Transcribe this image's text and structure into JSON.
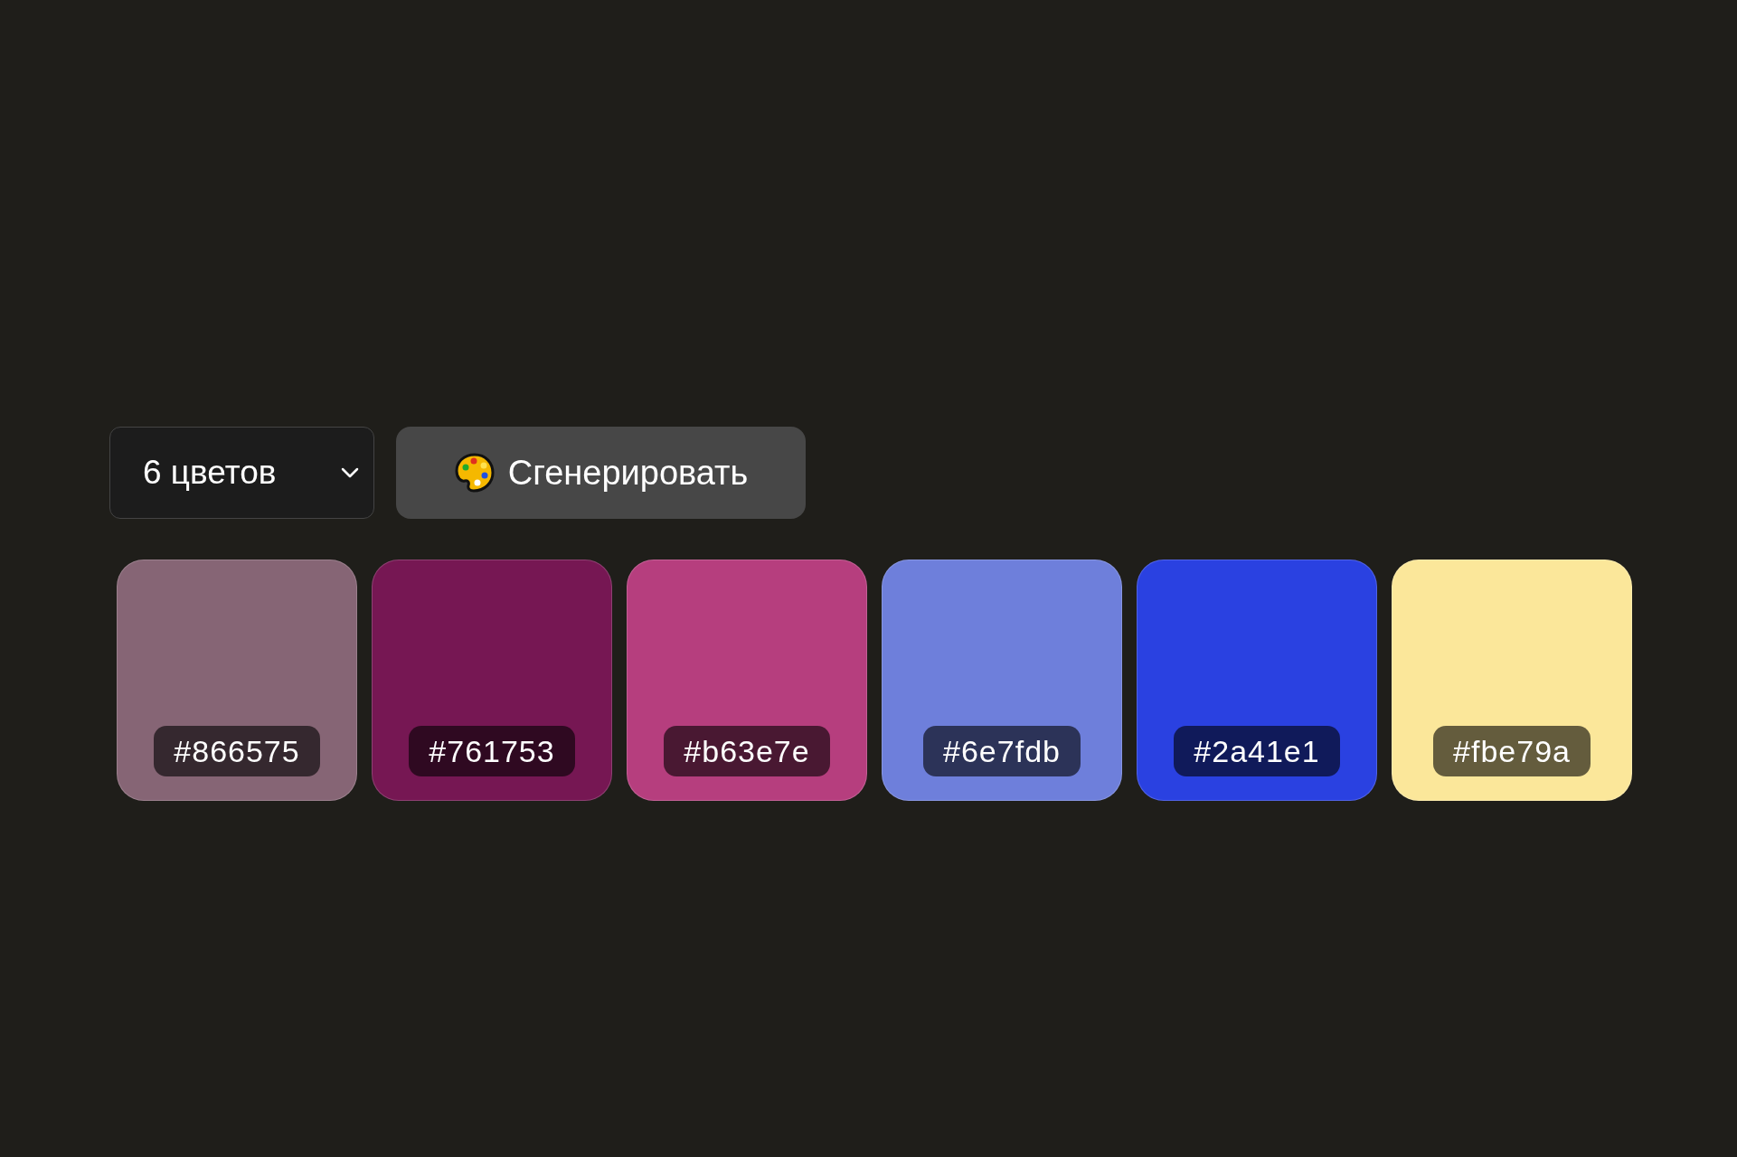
{
  "count_select": {
    "value": "6 цветов"
  },
  "generate_button": {
    "label": "Сгенерировать"
  },
  "swatches": [
    {
      "label": "#866575",
      "color": "#866575"
    },
    {
      "label": "#761753",
      "color": "#761753"
    },
    {
      "label": "#b63e7e",
      "color": "#b63e7e"
    },
    {
      "label": "#6e7fdb",
      "color": "#6e7fdb"
    },
    {
      "label": "#2a41e1",
      "color": "#2a41e1"
    },
    {
      "label": "#fbe79a",
      "color": "#fbe79a"
    }
  ]
}
